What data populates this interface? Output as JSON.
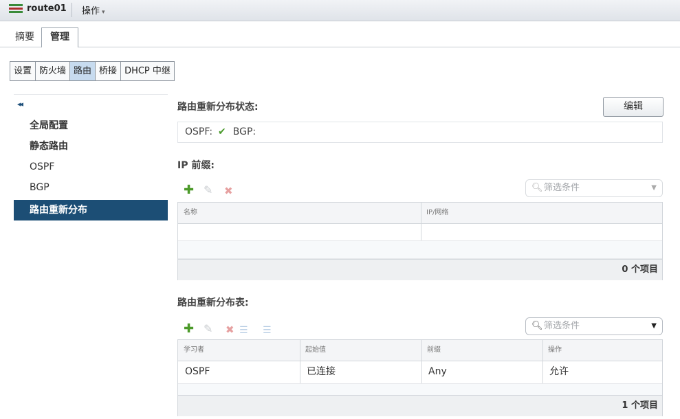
{
  "titlebar": {
    "icon": "vm-app-icon",
    "title": "route01",
    "actions_label": "操作",
    "actions_caret": "▾"
  },
  "main_tabs": [
    {
      "label": "摘要"
    },
    {
      "label": "管理"
    }
  ],
  "sub_tabs": [
    {
      "label": "设置"
    },
    {
      "label": "防火墙"
    },
    {
      "label": "路由",
      "active": true
    },
    {
      "label": "桥接"
    },
    {
      "label": "DHCP 中继"
    }
  ],
  "leftnav": {
    "collapse_glyph": "◂◂",
    "items": [
      {
        "label": "全局配置"
      },
      {
        "label": "静态路由"
      },
      {
        "label": "OSPF"
      },
      {
        "label": "BGP"
      },
      {
        "label": "路由重新分布",
        "active": true
      }
    ]
  },
  "redistribution_status": {
    "title": "路由重新分布状态:",
    "edit_label": "编辑",
    "ospf_label": "OSPF:",
    "ospf_check": "✔",
    "bgp_label": "BGP:"
  },
  "ip_prefix": {
    "title": "IP 前缀:",
    "filter_placeholder": "筛选条件",
    "columns": [
      "名称",
      "IP/网络"
    ],
    "count_text": "0 个项目"
  },
  "redistribution_table": {
    "title": "路由重新分布表:",
    "filter_placeholder": "筛选条件",
    "columns": [
      "学习者",
      "起始值",
      "前缀",
      "操作"
    ],
    "rows": [
      [
        "OSPF",
        "已连接",
        "Any",
        "允许"
      ]
    ],
    "count_text": "1 个项目"
  },
  "colors": {
    "active_nav_bg": "#1c4e75",
    "active_subtab_bg": "#c7dbef",
    "add_icon": "#4c9a2a",
    "check": "#4a9a2c"
  }
}
